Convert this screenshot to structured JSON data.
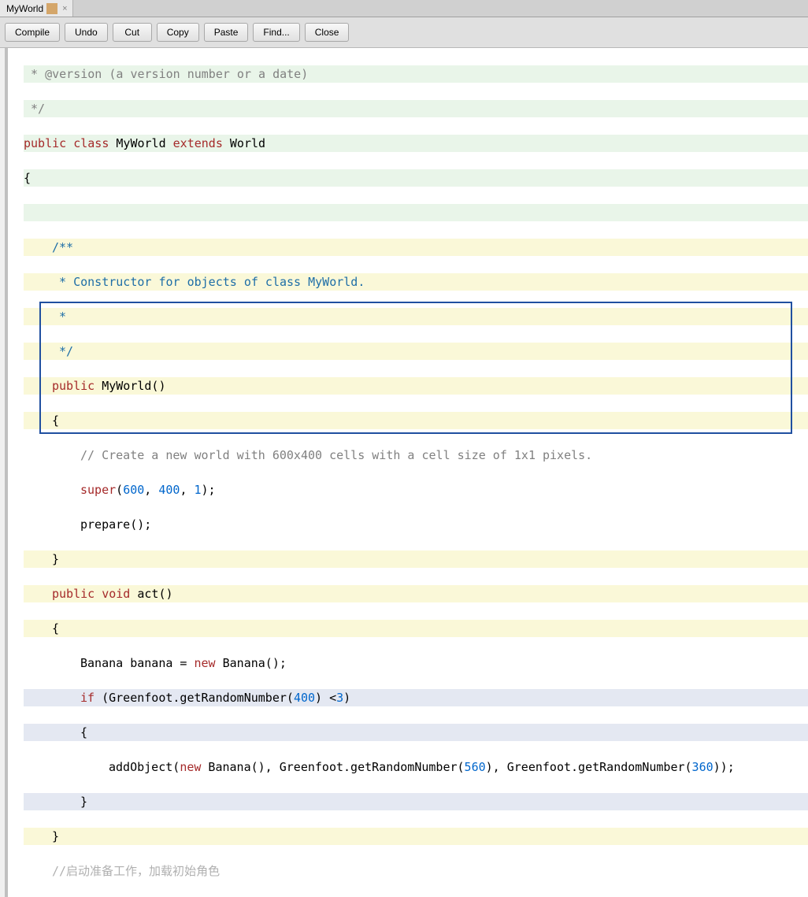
{
  "tab": {
    "title": "MyWorld",
    "close": "×"
  },
  "toolbar": {
    "compile": "Compile",
    "undo": "Undo",
    "cut": "Cut",
    "copy": "Copy",
    "paste": "Paste",
    "find": "Find...",
    "close": "Close"
  },
  "code": {
    "l1a": " * @version (a version number or a date)",
    "l2": " */",
    "l3_public": "public",
    "l3_class": "class",
    "l3_name": " MyWorld ",
    "l3_extends": "extends",
    "l3_world": " World",
    "l4": "{",
    "l5": "/**",
    "l6": " * Constructor for objects of class MyWorld.",
    "l7": " * ",
    "l8": " */",
    "l9_public": "public",
    "l9_rest": " MyWorld()",
    "l10": "{    ",
    "l11": "// Create a new world with 600x400 cells with a cell size of 1x1 pixels.",
    "l12_super": "super",
    "l12_a": "(",
    "l12_n1": "600",
    "l12_c1": ", ",
    "l12_n2": "400",
    "l12_c2": ", ",
    "l12_n3": "1",
    "l12_b": ");",
    "l13": "prepare();",
    "l14": "}",
    "l15_public": "public",
    "l15_sp": " ",
    "l15_void": "void",
    "l15_rest": " act()",
    "l16": "{",
    "l17a": "Banana banana = ",
    "l17_new": "new",
    "l17b": " Banana();",
    "l18_if": "if",
    "l18a": " (Greenfoot.getRandomNumber(",
    "l18_n1": "400",
    "l18b": ") <",
    "l18_n2": "3",
    "l18c": ")",
    "l19": "{",
    "l20a": "addObject(",
    "l20_new": "new",
    "l20b": " Banana(), Greenfoot.getRandomNumber(",
    "l20_n1": "560",
    "l20c": "), Greenfoot.getRandomNumber(",
    "l20_n2": "360",
    "l20d": "));",
    "l21": "}",
    "l22": "}",
    "l23": "//启动准备工作，加载初始角色"
  }
}
